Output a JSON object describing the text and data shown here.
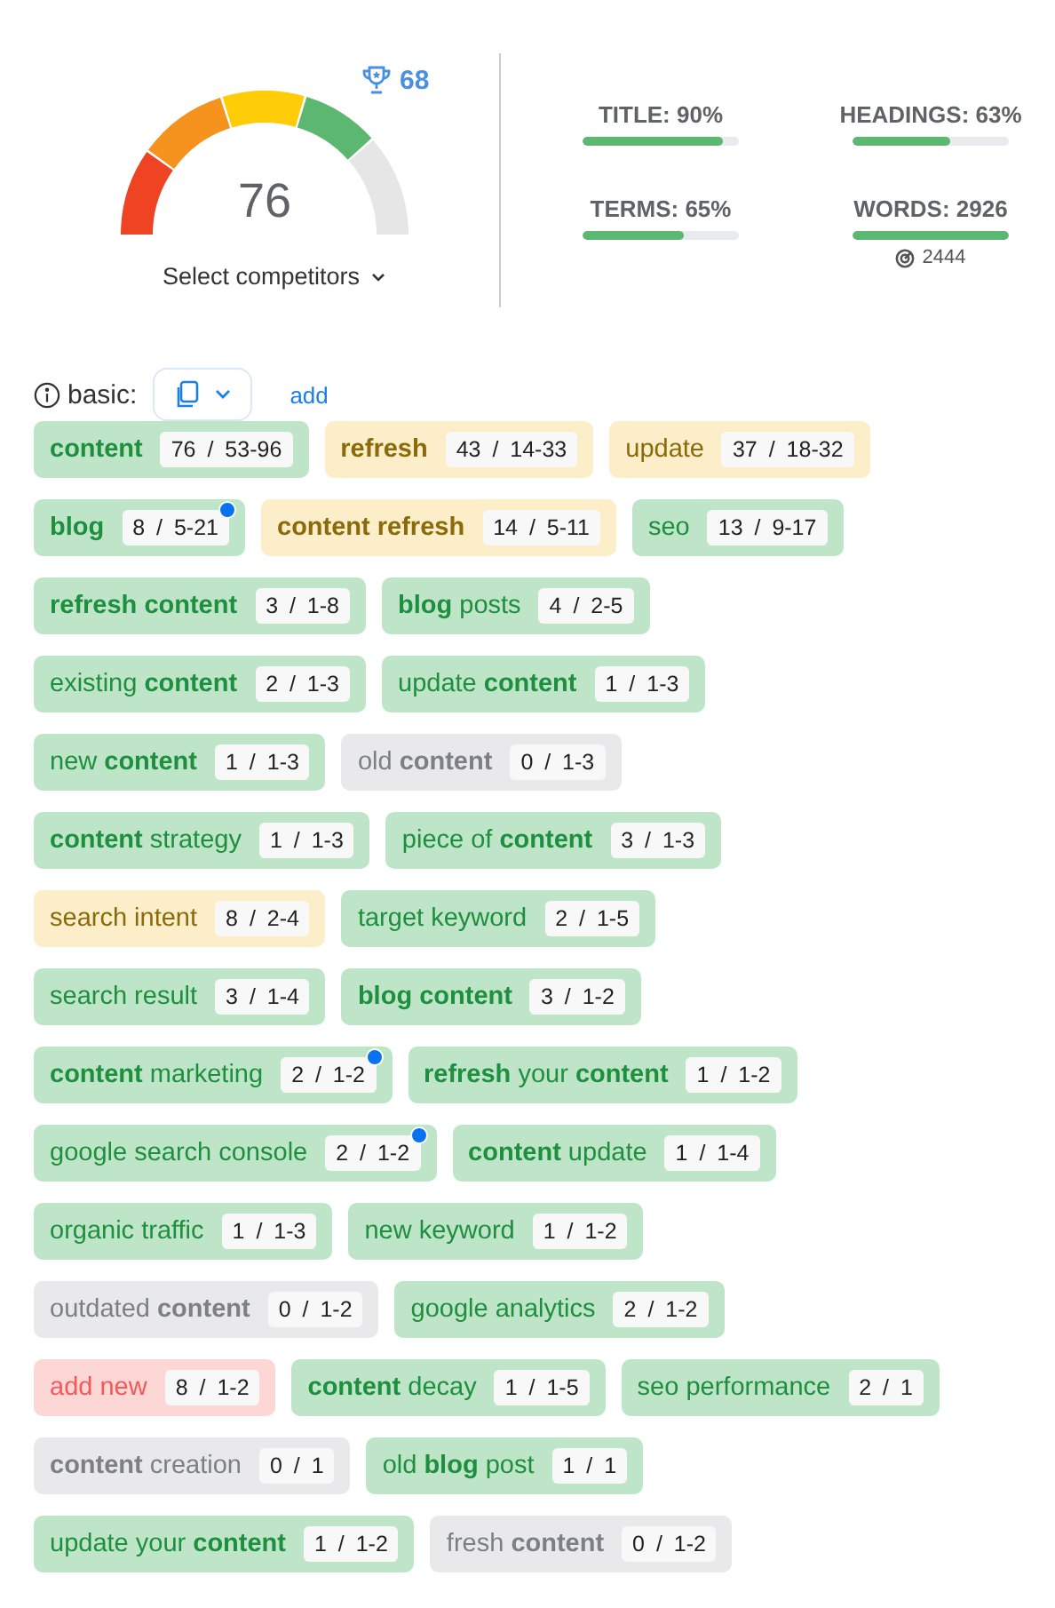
{
  "score": {
    "value": "76",
    "competitor_score": "68",
    "select_label": "Select competitors"
  },
  "metrics": [
    {
      "label": "TITLE: 90%",
      "level": 0.9
    },
    {
      "label": "HEADINGS: 63%",
      "level": 0.63
    },
    {
      "label": "TERMS: 65%",
      "level": 0.65
    },
    {
      "label": "WORDS: 2926",
      "level": 1,
      "target": "2444"
    }
  ],
  "section": {
    "label": "basic:",
    "add_link": "add"
  },
  "term_rows": [
    [
      {
        "term": "content",
        "bold": true,
        "count": "76 / 53-96",
        "kind": "ok",
        "dot": false
      },
      {
        "term": "refresh",
        "bold": true,
        "count": "43 / 14-33",
        "kind": "over",
        "dot": false
      },
      {
        "term": "update",
        "bold": false,
        "count": "37 / 18-32",
        "kind": "over",
        "dot": false
      }
    ],
    [
      {
        "term": "blog",
        "bold": true,
        "count": "8 / 5-21",
        "kind": "ok",
        "dot": true
      },
      {
        "term": "content refresh",
        "bold": true,
        "count": "14 / 5-11",
        "kind": "over",
        "dot": false
      },
      {
        "term": "seo",
        "bold": false,
        "count": "13 / 9-17",
        "kind": "ok",
        "dot": false
      }
    ],
    [
      {
        "term": "refresh content",
        "bold": true,
        "count": "3 / 1-8",
        "kind": "ok",
        "dot": false
      },
      {
        "term": "**blog** posts",
        "bold": false,
        "count": "4 / 2-5",
        "kind": "ok",
        "dot": false
      }
    ],
    [
      {
        "term": "existing **content**",
        "bold": false,
        "count": "2 / 1-3",
        "kind": "ok",
        "dot": false
      },
      {
        "term": "update **content**",
        "bold": false,
        "count": "1 / 1-3",
        "kind": "ok",
        "dot": false
      }
    ],
    [
      {
        "term": "new **content**",
        "bold": false,
        "count": "1 / 1-3",
        "kind": "ok",
        "dot": false
      },
      {
        "term": "old **content**",
        "bold": false,
        "count": "0 / 1-3",
        "kind": "missing",
        "dot": false
      }
    ],
    [
      {
        "term": "**content** strategy",
        "bold": false,
        "count": "1 / 1-3",
        "kind": "ok",
        "dot": false
      },
      {
        "term": "piece of **content**",
        "bold": false,
        "count": "3 / 1-3",
        "kind": "ok",
        "dot": false
      }
    ],
    [
      {
        "term": "search intent",
        "bold": false,
        "count": "8 / 2-4",
        "kind": "over",
        "dot": false
      },
      {
        "term": "target keyword",
        "bold": false,
        "count": "2 / 1-5",
        "kind": "ok",
        "dot": false
      }
    ],
    [
      {
        "term": "search result",
        "bold": false,
        "count": "3 / 1-4",
        "kind": "ok",
        "dot": false
      },
      {
        "term": "blog content",
        "bold": true,
        "count": "3 / 1-2",
        "kind": "ok",
        "dot": false
      }
    ],
    [
      {
        "term": "**content** marketing",
        "bold": false,
        "count": "2 / 1-2",
        "kind": "ok",
        "dot": true
      },
      {
        "term": "**refresh** your **content**",
        "bold": false,
        "count": "1 / 1-2",
        "kind": "ok",
        "dot": false
      }
    ],
    [
      {
        "term": "google search console",
        "bold": false,
        "count": "2 / 1-2",
        "kind": "ok",
        "dot": true
      },
      {
        "term": "**content** update",
        "bold": false,
        "count": "1 / 1-4",
        "kind": "ok",
        "dot": false
      }
    ],
    [
      {
        "term": "organic traffic",
        "bold": false,
        "count": "1 / 1-3",
        "kind": "ok",
        "dot": false
      },
      {
        "term": "new keyword",
        "bold": false,
        "count": "1 / 1-2",
        "kind": "ok",
        "dot": false
      }
    ],
    [
      {
        "term": "outdated **content**",
        "bold": false,
        "count": "0 / 1-2",
        "kind": "missing",
        "dot": false
      },
      {
        "term": "google analytics",
        "bold": false,
        "count": "2 / 1-2",
        "kind": "ok",
        "dot": false
      }
    ],
    [
      {
        "term": "add new",
        "bold": false,
        "count": "8 / 1-2",
        "kind": "excess",
        "dot": false
      },
      {
        "term": "**content** decay",
        "bold": false,
        "count": "1 / 1-5",
        "kind": "ok",
        "dot": false
      },
      {
        "term": "seo performance",
        "bold": false,
        "count": "2 / 1",
        "kind": "ok",
        "dot": false
      }
    ],
    [
      {
        "term": "**content** creation",
        "bold": false,
        "count": "0 / 1",
        "kind": "missing",
        "dot": false
      },
      {
        "term": "old **blog** post",
        "bold": false,
        "count": "1 / 1",
        "kind": "ok",
        "dot": false
      }
    ],
    [
      {
        "term": "update your **content**",
        "bold": false,
        "count": "1 / 1-2",
        "kind": "ok",
        "dot": false
      },
      {
        "term": "fresh **content**",
        "bold": false,
        "count": "0 / 1-2",
        "kind": "missing",
        "dot": false
      }
    ]
  ]
}
